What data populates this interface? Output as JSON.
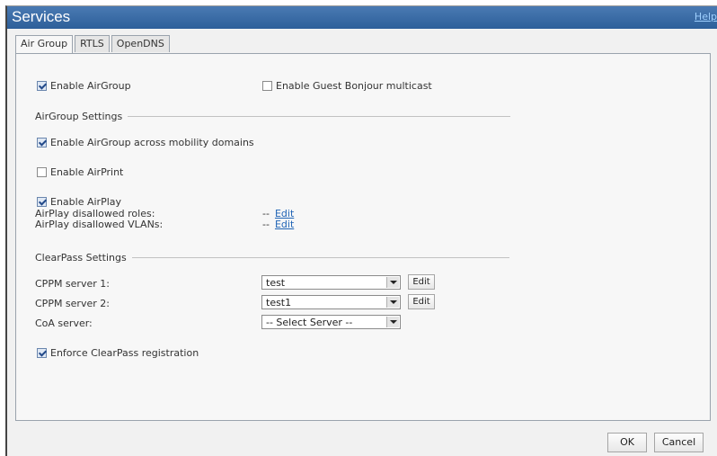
{
  "window": {
    "title": "Services",
    "help_link": "Help"
  },
  "tabs": [
    {
      "label": "Air Group",
      "active": true
    },
    {
      "label": "RTLS",
      "active": false
    },
    {
      "label": "OpenDNS",
      "active": false
    }
  ],
  "airgroup": {
    "enable_airgroup": {
      "label": "Enable AirGroup",
      "checked": true
    },
    "enable_guest_bonjour": {
      "label": "Enable Guest Bonjour multicast",
      "checked": false
    }
  },
  "airgroup_settings": {
    "heading": "AirGroup Settings",
    "across_mobility": {
      "label": "Enable AirGroup across mobility domains",
      "checked": true
    },
    "airprint": {
      "label": "Enable AirPrint",
      "checked": false
    },
    "airplay": {
      "label": "Enable AirPlay",
      "checked": true
    },
    "disallowed_roles": {
      "label": "AirPlay disallowed roles:",
      "value": "--",
      "edit": "Edit"
    },
    "disallowed_vlans": {
      "label": "AirPlay disallowed VLANs:",
      "value": "--",
      "edit": "Edit"
    }
  },
  "clearpass_settings": {
    "heading": "ClearPass Settings",
    "cppm1": {
      "label": "CPPM server 1:",
      "value": "test",
      "edit": "Edit"
    },
    "cppm2": {
      "label": "CPPM server 2:",
      "value": "test1",
      "edit": "Edit"
    },
    "coa": {
      "label": "CoA server:",
      "value": "-- Select Server --"
    },
    "enforce": {
      "label": "Enforce ClearPass registration",
      "checked": true
    }
  },
  "footer": {
    "ok": "OK",
    "cancel": "Cancel"
  },
  "colors": {
    "titlebar": "#2d5f9a",
    "link": "#1f63b5",
    "panel_bg": "#f7f7f7"
  }
}
